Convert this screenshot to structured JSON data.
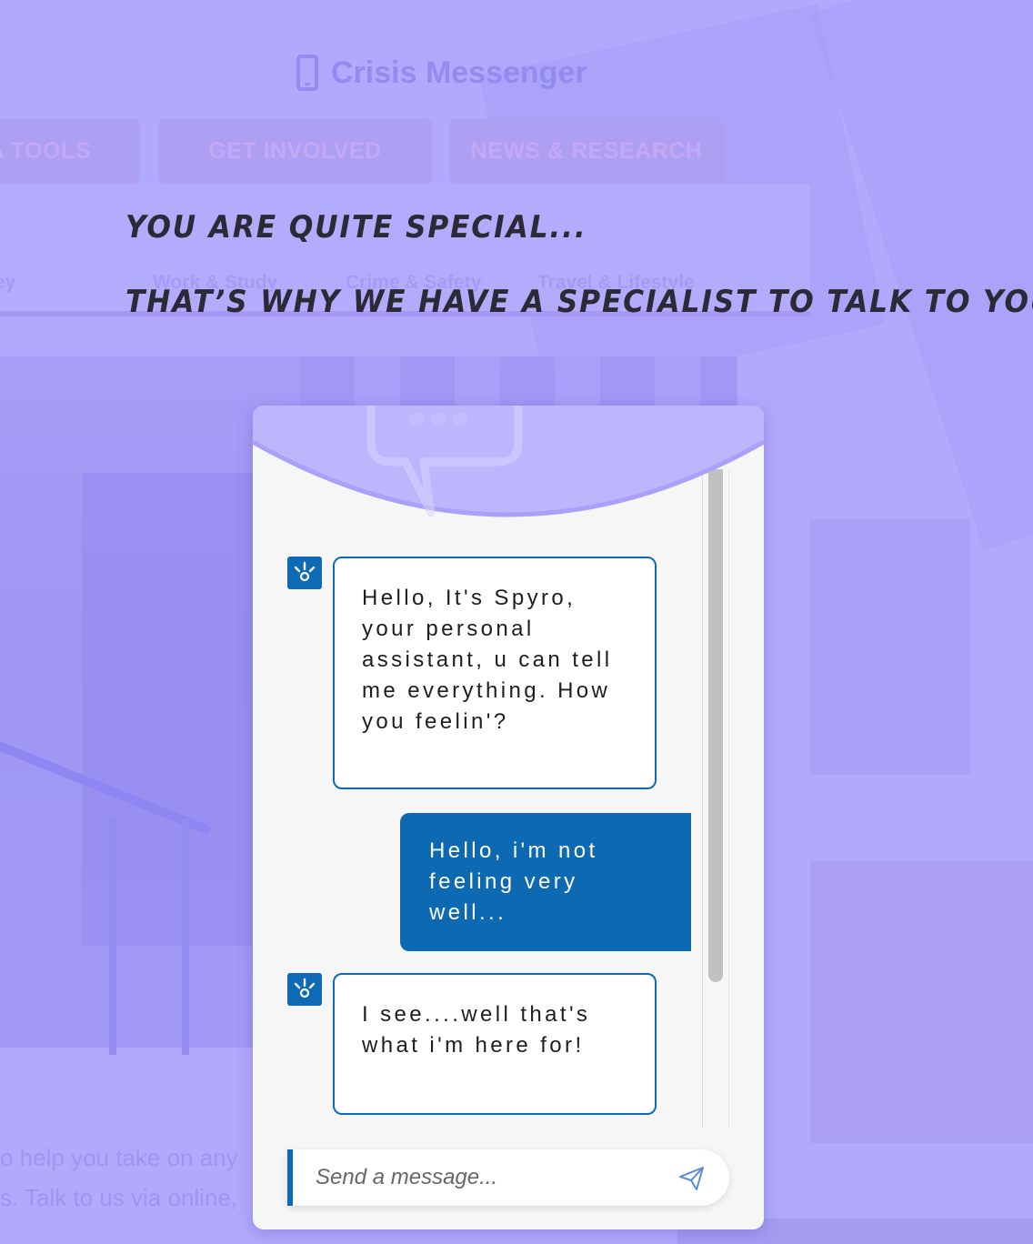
{
  "site": {
    "title": "Crisis Messenger",
    "icons": {
      "brand": "phone-icon"
    },
    "nav": [
      {
        "label": "A TOOLS"
      },
      {
        "label": "GET INVOLVED"
      },
      {
        "label": "NEWS & RESEARCH"
      }
    ],
    "subnav": [
      {
        "label": "ey"
      },
      {
        "label": "Work & Study"
      },
      {
        "label": "Crime & Safety"
      },
      {
        "label": "Travel & Lifestyle"
      }
    ],
    "paragraph": [
      "o help you take on any",
      "s. Talk to us via online,"
    ]
  },
  "headline": {
    "line1": "You are quite special...",
    "line2": "That’s why we have a specialist to talk to you"
  },
  "chat": {
    "header_icon": "chat-bubble-icon",
    "bot_avatar_icon": "lightbulb-icon",
    "messages": [
      {
        "from": "bot",
        "text": "Hello, It's Spyro, your personal assistant, u can tell me everything. How you feelin'?"
      },
      {
        "from": "user",
        "text": "Hello, i'm not feeling very well..."
      },
      {
        "from": "bot",
        "text": "I see....well that's what i'm here for!"
      }
    ],
    "input": {
      "placeholder": "Send a message...",
      "value": ""
    },
    "send_icon": "paper-plane-icon"
  },
  "colors": {
    "overlay": "#b1a9fd",
    "accent_blue": "#0e6ab4",
    "headline": "#2b2a36"
  }
}
